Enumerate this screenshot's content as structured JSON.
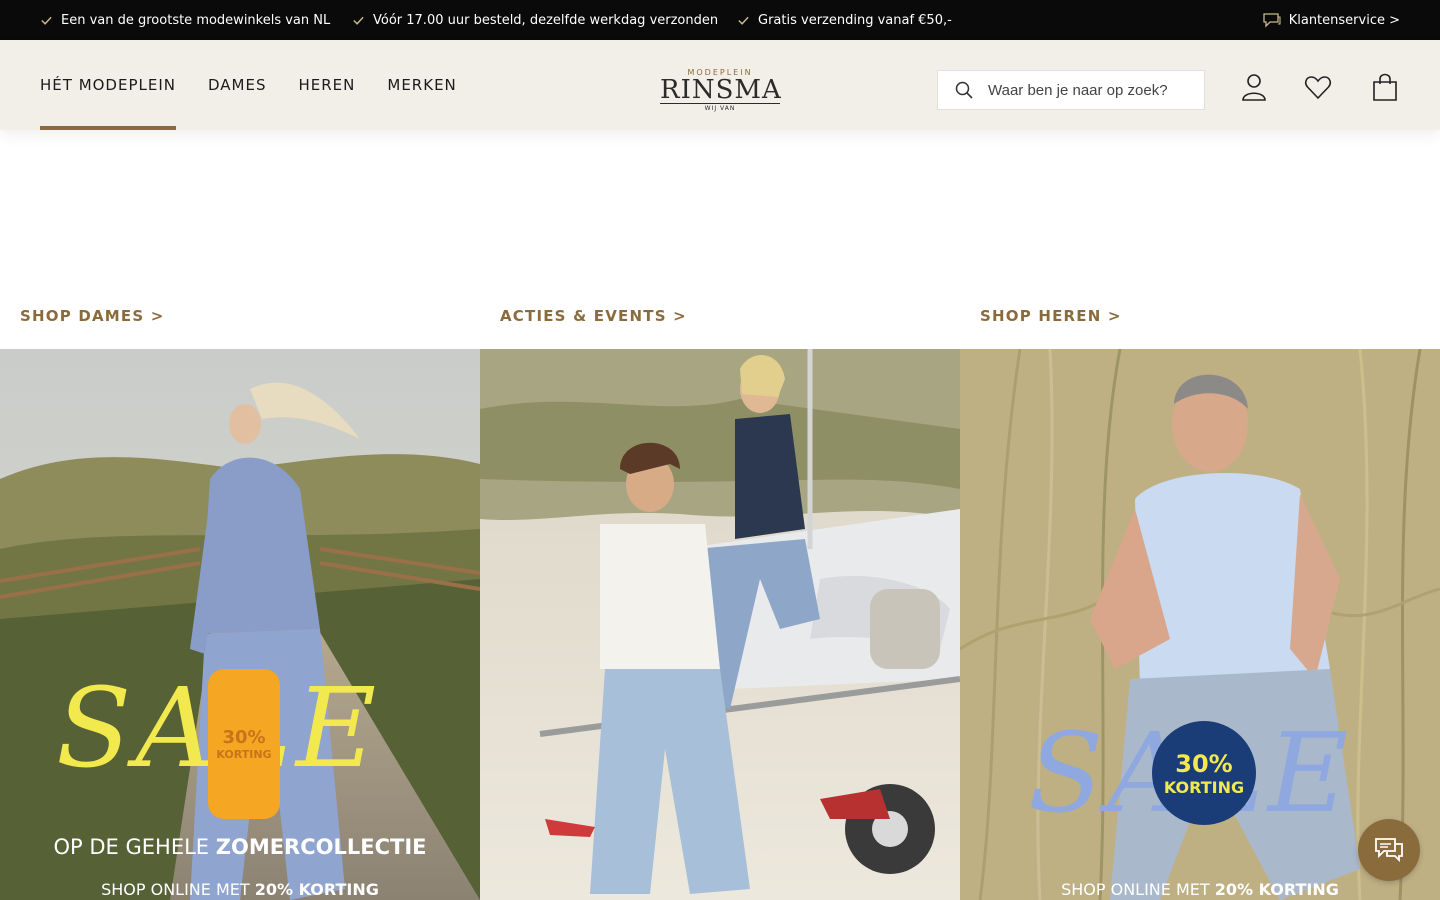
{
  "topbar": {
    "usps": [
      "Een van de grootste modewinkels van NL",
      "Vóór 17.00 uur besteld, dezelfde werkdag verzonden",
      "Gratis verzending vanaf €50,-"
    ],
    "service_label": "Klantenservice >"
  },
  "header": {
    "nav": [
      "HÉT MODEPLEIN",
      "DAMES",
      "HEREN",
      "MERKEN"
    ],
    "active_nav": "HÉT MODEPLEIN",
    "logo": {
      "top": "MODEPLEIN",
      "main": "RINSMA",
      "bottom": "WIJ VAN"
    },
    "search_placeholder": "Waar ben je naar op zoek?"
  },
  "links": {
    "shop_dames": "SHOP DAMES >",
    "acties": "ACTIES & EVENTS >",
    "shop_heren": "SHOP HEREN >"
  },
  "tiles": {
    "dames": {
      "sale_word": "SALE",
      "badge_percent": "30%",
      "badge_label": "KORTING",
      "line1_light": "OP DE GEHELE ",
      "line1_bold": "ZOMERCOLLECTIE",
      "line2_light": "SHOP ONLINE MET ",
      "line2_bold": "20% KORTING"
    },
    "heren": {
      "sale_word": "SALE",
      "badge_percent": "30%",
      "badge_label": "KORTING",
      "line2_light": "SHOP ONLINE MET ",
      "line2_bold": "20% KORTING"
    }
  },
  "colors": {
    "accent": "#8a6b3c",
    "header_bg": "#f2efe8",
    "topbar_bg": "#0a0a0a",
    "sale_yellow": "#f2e94e",
    "sale_blue": "#8fa8e0",
    "badge_navy": "#1a3d78"
  }
}
